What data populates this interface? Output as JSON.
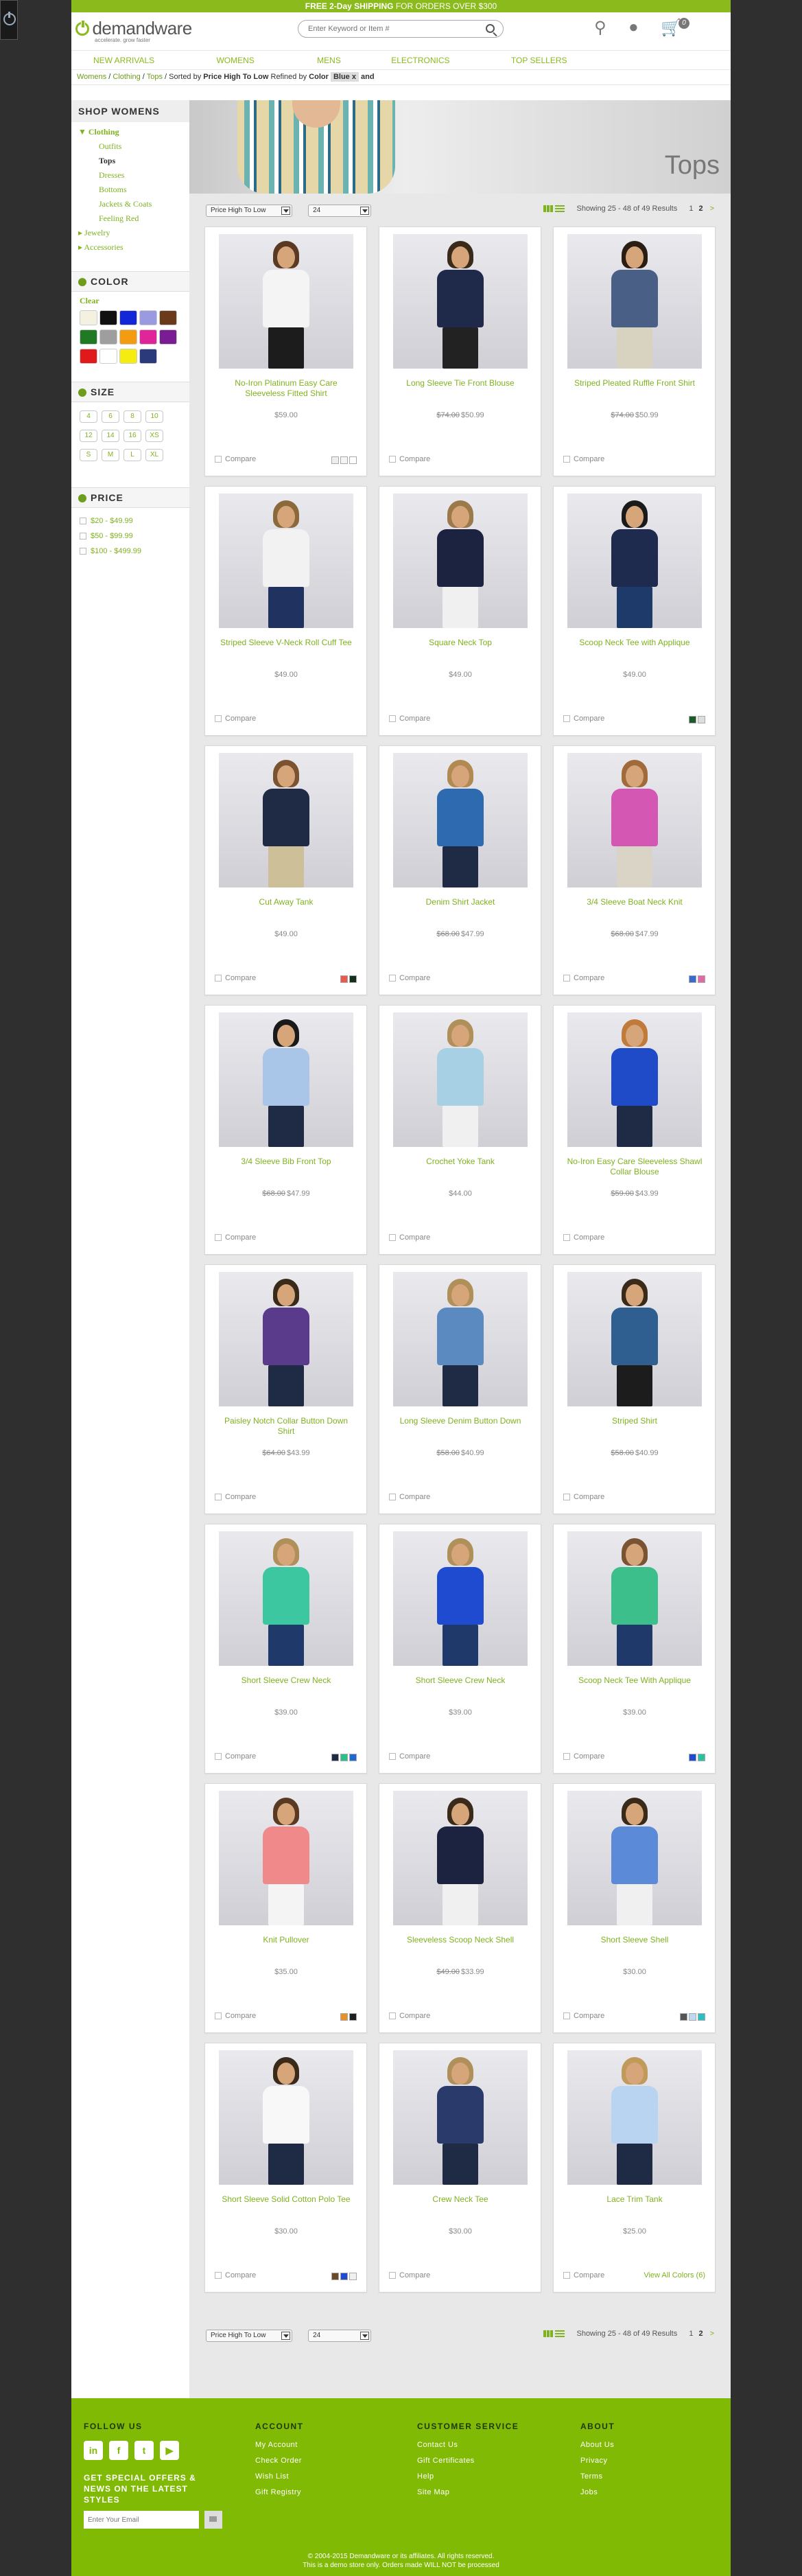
{
  "promo": {
    "bold": "FREE 2-Day SHIPPING",
    "rest": " FOR ORDERS OVER $300"
  },
  "header": {
    "logo_name": "demandware",
    "logo_tag": "accelerate. grow faster",
    "search_placeholder": "Enter Keyword or Item #",
    "cart_count": "0"
  },
  "nav": [
    "NEW ARRIVALS",
    "WOMENS",
    "MENS",
    "ELECTRONICS",
    "TOP SELLERS"
  ],
  "breadcrumb": {
    "items": [
      "Womens",
      "Clothing",
      "Tops"
    ],
    "sorted_label": "Sorted by",
    "sorted_value": "Price High To Low",
    "refined_label": "Refined by",
    "refined_attr": "Color",
    "refined_value": "Blue",
    "remove": "x",
    "and": "and"
  },
  "left": {
    "title": "SHOP WOMENS",
    "categories": [
      {
        "label": "Clothing"
      },
      {
        "label": "Outfits"
      },
      {
        "label": "Tops"
      },
      {
        "label": "Dresses"
      },
      {
        "label": "Bottoms"
      },
      {
        "label": "Jackets & Coats"
      },
      {
        "label": "Feeling Red"
      },
      {
        "label": "Jewelry"
      },
      {
        "label": "Accessories"
      }
    ],
    "color_title": "COLOR",
    "clear": "Clear",
    "swatches": [
      "#f4f1e0",
      "#111111",
      "#1326d8",
      "#9a9ae0",
      "#6b3a1a",
      "#1f7a23",
      "#9e9e9e",
      "#f39c12",
      "#e0259a",
      "#7a1d94",
      "#e01a1a",
      "#ffffff",
      "#f5ec12",
      "#2b3a7a"
    ],
    "size_title": "SIZE",
    "sizes": [
      "4",
      "6",
      "8",
      "10",
      "12",
      "14",
      "16",
      "XS",
      "S",
      "M",
      "L",
      "XL"
    ],
    "price_title": "PRICE",
    "prices": [
      "$20 - $49.99",
      "$50 - $99.99",
      "$100 - $499.99"
    ]
  },
  "main": {
    "banner_title": "Tops",
    "sort_value": "Price High To Low",
    "page_size": "24",
    "showing": "Showing 25 - 48 of 49 Results",
    "page_prev": "1",
    "page_cur": "2",
    "page_next": ">",
    "compare_label": "Compare",
    "view_all_colors": "View All Colors (6)"
  },
  "products": [
    {
      "name": "No-Iron Platinum Easy Care Sleeveless Fitted Shirt",
      "old": "",
      "price": "$59.00",
      "swatches": [
        "#eeeeee",
        "#f4f4f4",
        "#ffffff"
      ],
      "top": "#f4f4f4",
      "bottom": "#1c1c1c",
      "hair": "#5a3a22"
    },
    {
      "name": "Long Sleeve Tie Front Blouse",
      "old": "$74.00",
      "price": "$50.99",
      "swatches": [],
      "top": "#1f2a4a",
      "bottom": "#222222",
      "hair": "#3a2a1a"
    },
    {
      "name": "Striped Pleated Ruffle Front Shirt",
      "old": "$74.00",
      "price": "$50.99",
      "swatches": [],
      "top": "#4a5f85",
      "bottom": "#d8d2c0",
      "hair": "#2a1d12"
    },
    {
      "name": "Striped Sleeve V-Neck Roll Cuff Tee",
      "old": "",
      "price": "$49.00",
      "swatches": [],
      "top": "#f2f2f2",
      "bottom": "#1f3260",
      "hair": "#8a6a3a"
    },
    {
      "name": "Square Neck Top",
      "old": "",
      "price": "$49.00",
      "swatches": [],
      "top": "#1b2340",
      "bottom": "#f0f0f0",
      "hair": "#9a7a4a"
    },
    {
      "name": "Scoop Neck Tee with Applique",
      "old": "",
      "price": "$49.00",
      "swatches": [
        "#1c5a2a",
        "#dddddd"
      ],
      "top": "#1e2a4e",
      "bottom": "#1e3a6a",
      "hair": "#1a1a1a"
    },
    {
      "name": "Cut Away Tank",
      "old": "",
      "price": "$49.00",
      "swatches": [
        "#e85a4a",
        "#14301a"
      ],
      "top": "#1f2a44",
      "bottom": "#cdbf98",
      "hair": "#7a5432"
    },
    {
      "name": "Denim Shirt Jacket",
      "old": "$68.00",
      "price": "$47.99",
      "swatches": [],
      "top": "#2d6ab0",
      "bottom": "#1f2a44",
      "hair": "#b08a52"
    },
    {
      "name": "3/4 Sleeve Boat Neck Knit",
      "old": "$68.00",
      "price": "$47.99",
      "swatches": [
        "#3a6ad0",
        "#e06aa8"
      ],
      "top": "#d457b4",
      "bottom": "#d9d4c6",
      "hair": "#a06a3a"
    },
    {
      "name": "3/4 Sleeve Bib Front Top",
      "old": "$68.00",
      "price": "$47.99",
      "swatches": [],
      "top": "#a9c6e8",
      "bottom": "#1f2a44",
      "hair": "#1a1a1a"
    },
    {
      "name": "Crochet Yoke Tank",
      "old": "",
      "price": "$44.00",
      "swatches": [],
      "top": "#a8d0e4",
      "bottom": "#f0f0f0",
      "hair": "#b0905a"
    },
    {
      "name": "No-Iron Easy Care Sleeveless Shawl Collar Blouse",
      "old": "$59.00",
      "price": "$43.99",
      "swatches": [],
      "top": "#1f4bc8",
      "bottom": "#1f2a44",
      "hair": "#c07a3a"
    },
    {
      "name": "Paisley Notch Collar Button Down Shirt",
      "old": "$64.00",
      "price": "$43.99",
      "swatches": [],
      "top": "#5a3a8a",
      "bottom": "#1f2a44",
      "hair": "#3a2a1a"
    },
    {
      "name": "Long Sleeve Denim Button Down",
      "old": "$58.00",
      "price": "$40.99",
      "swatches": [],
      "top": "#5a8ac0",
      "bottom": "#1f2a44",
      "hair": "#b0905a"
    },
    {
      "name": "Striped Shirt",
      "old": "$58.00",
      "price": "$40.99",
      "swatches": [],
      "top": "#2f5f90",
      "bottom": "#1c1c1c",
      "hair": "#3a2a1a"
    },
    {
      "name": "Short Sleeve Crew Neck",
      "old": "",
      "price": "$39.00",
      "swatches": [
        "#1f2a44",
        "#2bc08a",
        "#1f6ad0"
      ],
      "top": "#3cc7a0",
      "bottom": "#1f3a6a",
      "hair": "#b0905a"
    },
    {
      "name": "Short Sleeve Crew Neck",
      "old": "",
      "price": "$39.00",
      "swatches": [],
      "top": "#1f4bd0",
      "bottom": "#1f3a6a",
      "hair": "#b0905a"
    },
    {
      "name": "Scoop Neck Tee With Applique",
      "old": "",
      "price": "$39.00",
      "swatches": [
        "#1f4bd0",
        "#2bc0a0"
      ],
      "top": "#3cbf8a",
      "bottom": "#1f3a6a",
      "hair": "#7a5432"
    },
    {
      "name": "Knit Pullover",
      "old": "",
      "price": "$35.00",
      "swatches": [
        "#e8902a",
        "#1f1f1f"
      ],
      "top": "#f08a8a",
      "bottom": "#f4f4f4",
      "hair": "#5a3a22"
    },
    {
      "name": "Sleeveless Scoop Neck Shell",
      "old": "$49.00",
      "price": "$33.99",
      "swatches": [],
      "top": "#1b2340",
      "bottom": "#f0f0f0",
      "hair": "#3a2a1a"
    },
    {
      "name": "Short Sleeve Shell",
      "old": "",
      "price": "$30.00",
      "swatches": [
        "#555555",
        "#bdd8f0",
        "#2bc0c0"
      ],
      "top": "#5a8ad8",
      "bottom": "#f0f0f0",
      "hair": "#3a2a1a"
    },
    {
      "name": "Short Sleeve Solid Cotton Polo Tee",
      "old": "",
      "price": "$30.00",
      "swatches": [
        "#6a4a2a",
        "#1f4bd0",
        "#f0f0f0"
      ],
      "top": "#f8f8f8",
      "bottom": "#1f2a44",
      "hair": "#3a2a1a"
    },
    {
      "name": "Crew Neck Tee",
      "old": "",
      "price": "$30.00",
      "swatches": [],
      "top": "#2a3a6a",
      "bottom": "#1f2a44",
      "hair": "#b0905a"
    },
    {
      "name": "Lace Trim Tank",
      "old": "",
      "price": "$25.00",
      "swatches": [],
      "top": "#b8d4f0",
      "bottom": "#1f2a44",
      "hair": "#c09a5a"
    }
  ],
  "footer": {
    "follow": "FOLLOW US",
    "social": [
      "in",
      "f",
      "t",
      "▶"
    ],
    "offers": "GET SPECIAL OFFERS & NEWS ON THE LATEST STYLES",
    "email_placeholder": "Enter Your Email",
    "account_title": "ACCOUNT",
    "account_links": [
      "My Account",
      "Check Order",
      "Wish List",
      "Gift Registry"
    ],
    "service_title": "CUSTOMER SERVICE",
    "service_links": [
      "Contact Us",
      "Gift Certificates",
      "Help",
      "Site Map"
    ],
    "about_title": "ABOUT",
    "about_links": [
      "About Us",
      "Privacy",
      "Terms",
      "Jobs"
    ],
    "copy1": "© 2004-2015 Demandware or its affiliates. All rights reserved.",
    "copy2": "This is a demo store only. Orders made WILL NOT be processed"
  }
}
